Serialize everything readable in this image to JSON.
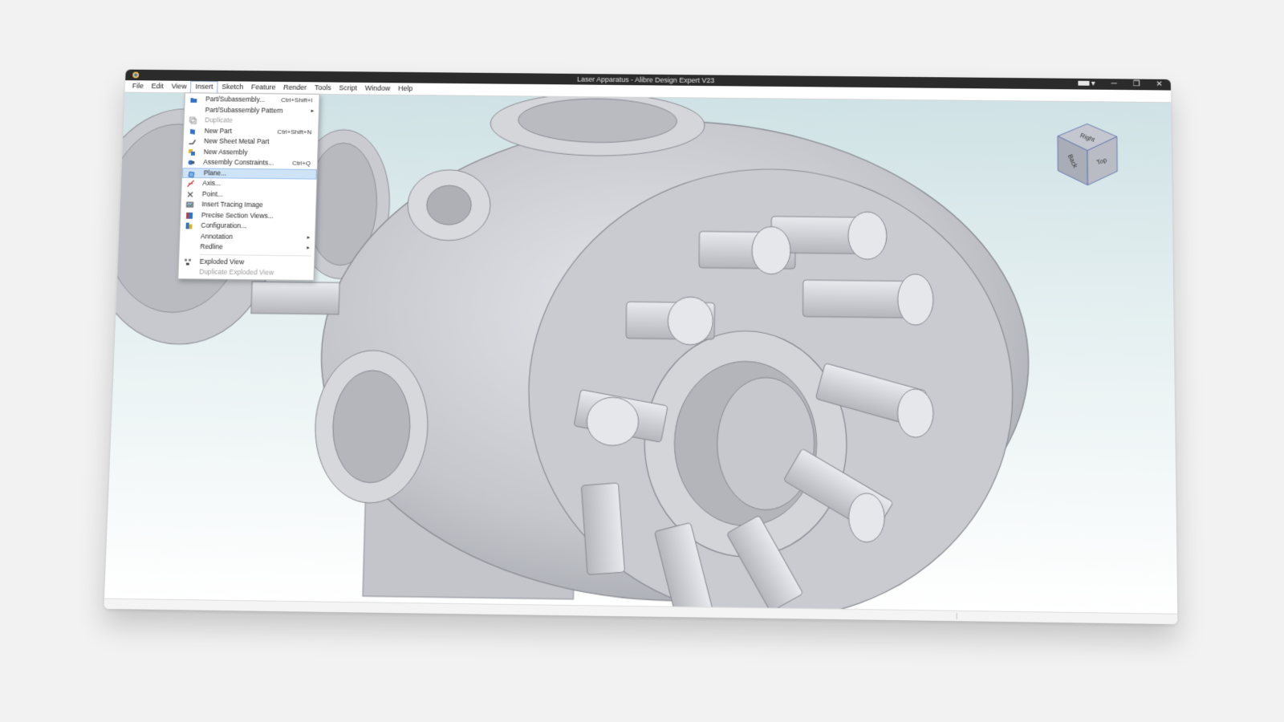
{
  "window": {
    "title": "Laser Apparatus - Alibre Design Expert V23"
  },
  "title_controls": {
    "minimize": "─",
    "restore": "❐",
    "close": "✕"
  },
  "menubar": {
    "items": [
      {
        "label": "File"
      },
      {
        "label": "Edit"
      },
      {
        "label": "View"
      },
      {
        "label": "Insert",
        "active": true
      },
      {
        "label": "Sketch"
      },
      {
        "label": "Feature"
      },
      {
        "label": "Render"
      },
      {
        "label": "Tools"
      },
      {
        "label": "Script"
      },
      {
        "label": "Window"
      },
      {
        "label": "Help"
      }
    ]
  },
  "insert_menu": {
    "items": [
      {
        "label": "Part/Subassembly...",
        "shortcut": "Ctrl+Shift+I",
        "icon": "folder-icon"
      },
      {
        "label": "Part/Subassembly Pattern",
        "submenu": true,
        "icon": ""
      },
      {
        "label": "Duplicate",
        "disabled": true,
        "icon": "duplicate-icon"
      },
      {
        "label": "New Part",
        "shortcut": "Ctrl+Shift+N",
        "icon": "part-icon"
      },
      {
        "label": "New Sheet Metal Part",
        "icon": "sheet-metal-icon"
      },
      {
        "label": "New Assembly",
        "icon": "assembly-icon"
      },
      {
        "label": "Assembly Constraints...",
        "shortcut": "Ctrl+Q",
        "icon": "constraint-icon"
      },
      {
        "label": "Plane...",
        "selected": true,
        "icon": "plane-icon"
      },
      {
        "label": "Axis...",
        "icon": "axis-icon"
      },
      {
        "label": "Point...",
        "icon": "point-icon"
      },
      {
        "label": "Insert Tracing Image",
        "icon": "image-icon"
      },
      {
        "label": "Precise Section Views...",
        "icon": "section-icon"
      },
      {
        "label": "Configuration...",
        "icon": "configuration-icon"
      },
      {
        "label": "Annotation",
        "submenu": true,
        "icon": ""
      },
      {
        "label": "Redline",
        "submenu": true,
        "icon": ""
      },
      {
        "separator": true
      },
      {
        "label": "Exploded View",
        "icon": "exploded-view-icon"
      },
      {
        "label": "Duplicate Exploded View",
        "disabled": true,
        "icon": ""
      }
    ]
  },
  "viewcube": {
    "top": "Top",
    "back": "Back",
    "right": "Right"
  },
  "colors": {
    "accent": "#2f73c8",
    "selection": "#cfe3f7",
    "titlebar": "#2b2b2b",
    "model": "#c9cbd1"
  }
}
